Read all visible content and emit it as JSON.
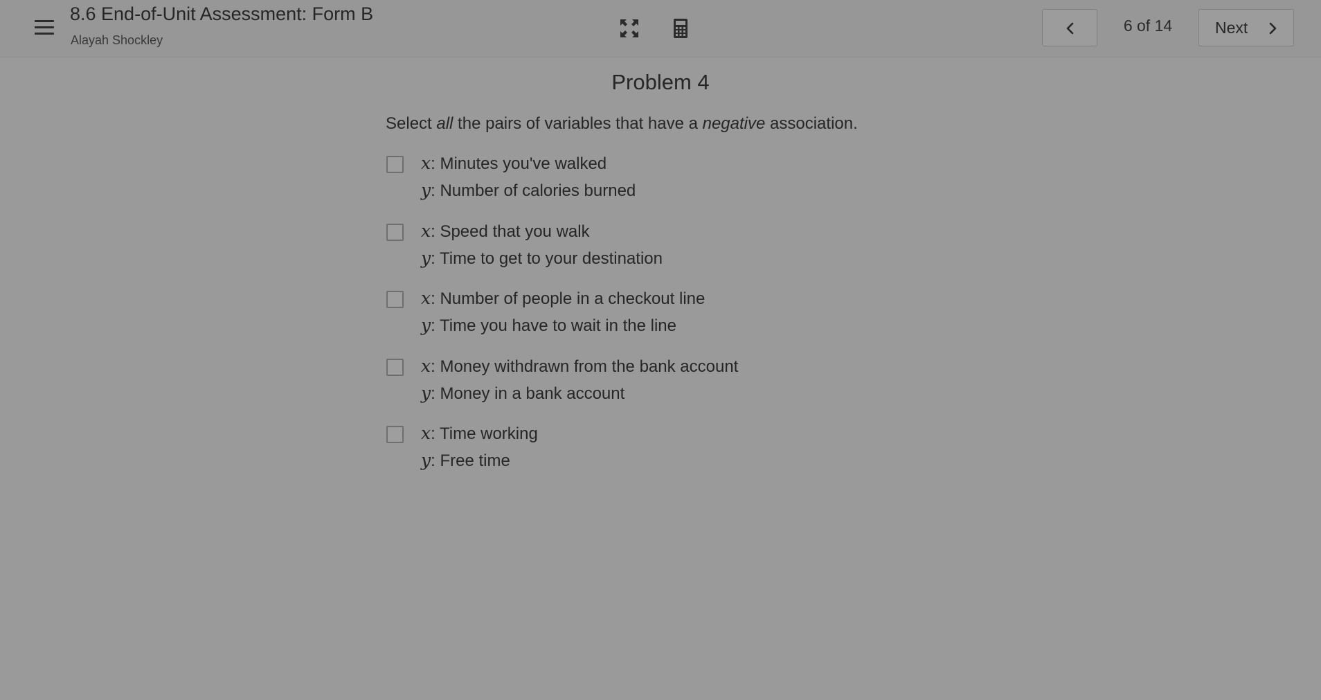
{
  "header": {
    "title": "8.6 End-of-Unit Assessment: Form B",
    "student_name": "Alayah Shockley",
    "page_counter": "6 of 14",
    "next_label": "Next",
    "icons": {
      "menu": "hamburger-menu-icon",
      "expand": "expand-arrows-icon",
      "calculator": "calculator-icon",
      "prev": "chevron-left-icon",
      "next": "chevron-right-icon"
    }
  },
  "problem": {
    "title": "Problem 4",
    "prompt_parts": [
      "Select ",
      "all",
      " the pairs of variables that have a ",
      "negative",
      " association."
    ],
    "options": [
      {
        "x_var": "x",
        "x_text": ": Minutes you've walked",
        "y_var": "y",
        "y_text": ": Number of calories burned",
        "checked": false
      },
      {
        "x_var": "x",
        "x_text": ": Speed that you walk",
        "y_var": "y",
        "y_text": ": Time to get to your destination",
        "checked": false
      },
      {
        "x_var": "x",
        "x_text": ": Number of people in a checkout line",
        "y_var": "y",
        "y_text": ": Time you have to wait in the line",
        "checked": false
      },
      {
        "x_var": "x",
        "x_text": ": Money withdrawn from the bank account",
        "y_var": "y",
        "y_text": ": Money in a bank account",
        "checked": false
      },
      {
        "x_var": "x",
        "x_text": ": Time working",
        "y_var": "y",
        "y_text": ": Free time",
        "checked": false
      }
    ]
  },
  "colors": {
    "overlay_background": "#9a9a9a",
    "text": "#262626"
  }
}
